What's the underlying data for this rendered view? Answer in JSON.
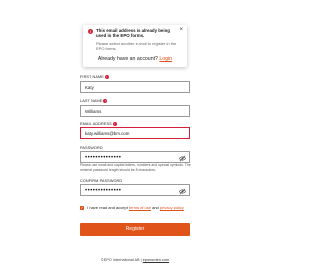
{
  "toast": {
    "icon": "error-icon",
    "title": "This email address is already being used in the EPO forms.",
    "message": "Please select another e-mail to register in the EPO forms.",
    "close": "×"
  },
  "already": {
    "text": "Already have an account?",
    "link": "Login"
  },
  "form": {
    "first_name": {
      "label": "FIRST NAME",
      "value": "Katy"
    },
    "last_name": {
      "label": "LAST NAME",
      "value": "Williams"
    },
    "email": {
      "label": "EMAIL ADDRESS",
      "value": "katy.williams@bm.com"
    },
    "password": {
      "label": "PASSWORD",
      "value": "••••••••••••••",
      "hint": "Please use small and capital letters, numbers and special symbols. The minimal password length should be 8 characters."
    },
    "confirm_password": {
      "label": "CONFIRM PASSWORD",
      "value": "••••••••••••••"
    },
    "terms": {
      "text": "I have read and accept",
      "terms_link": "terms of use",
      "and": "and",
      "privacy_link": "privacy policy",
      "checked": true
    },
    "register_label": "Register"
  },
  "footer": {
    "copyright": "©EPO International AB",
    "separator": "|",
    "site": "eponorden.com"
  },
  "colors": {
    "accent": "#e0531a",
    "error": "#d6203a"
  }
}
